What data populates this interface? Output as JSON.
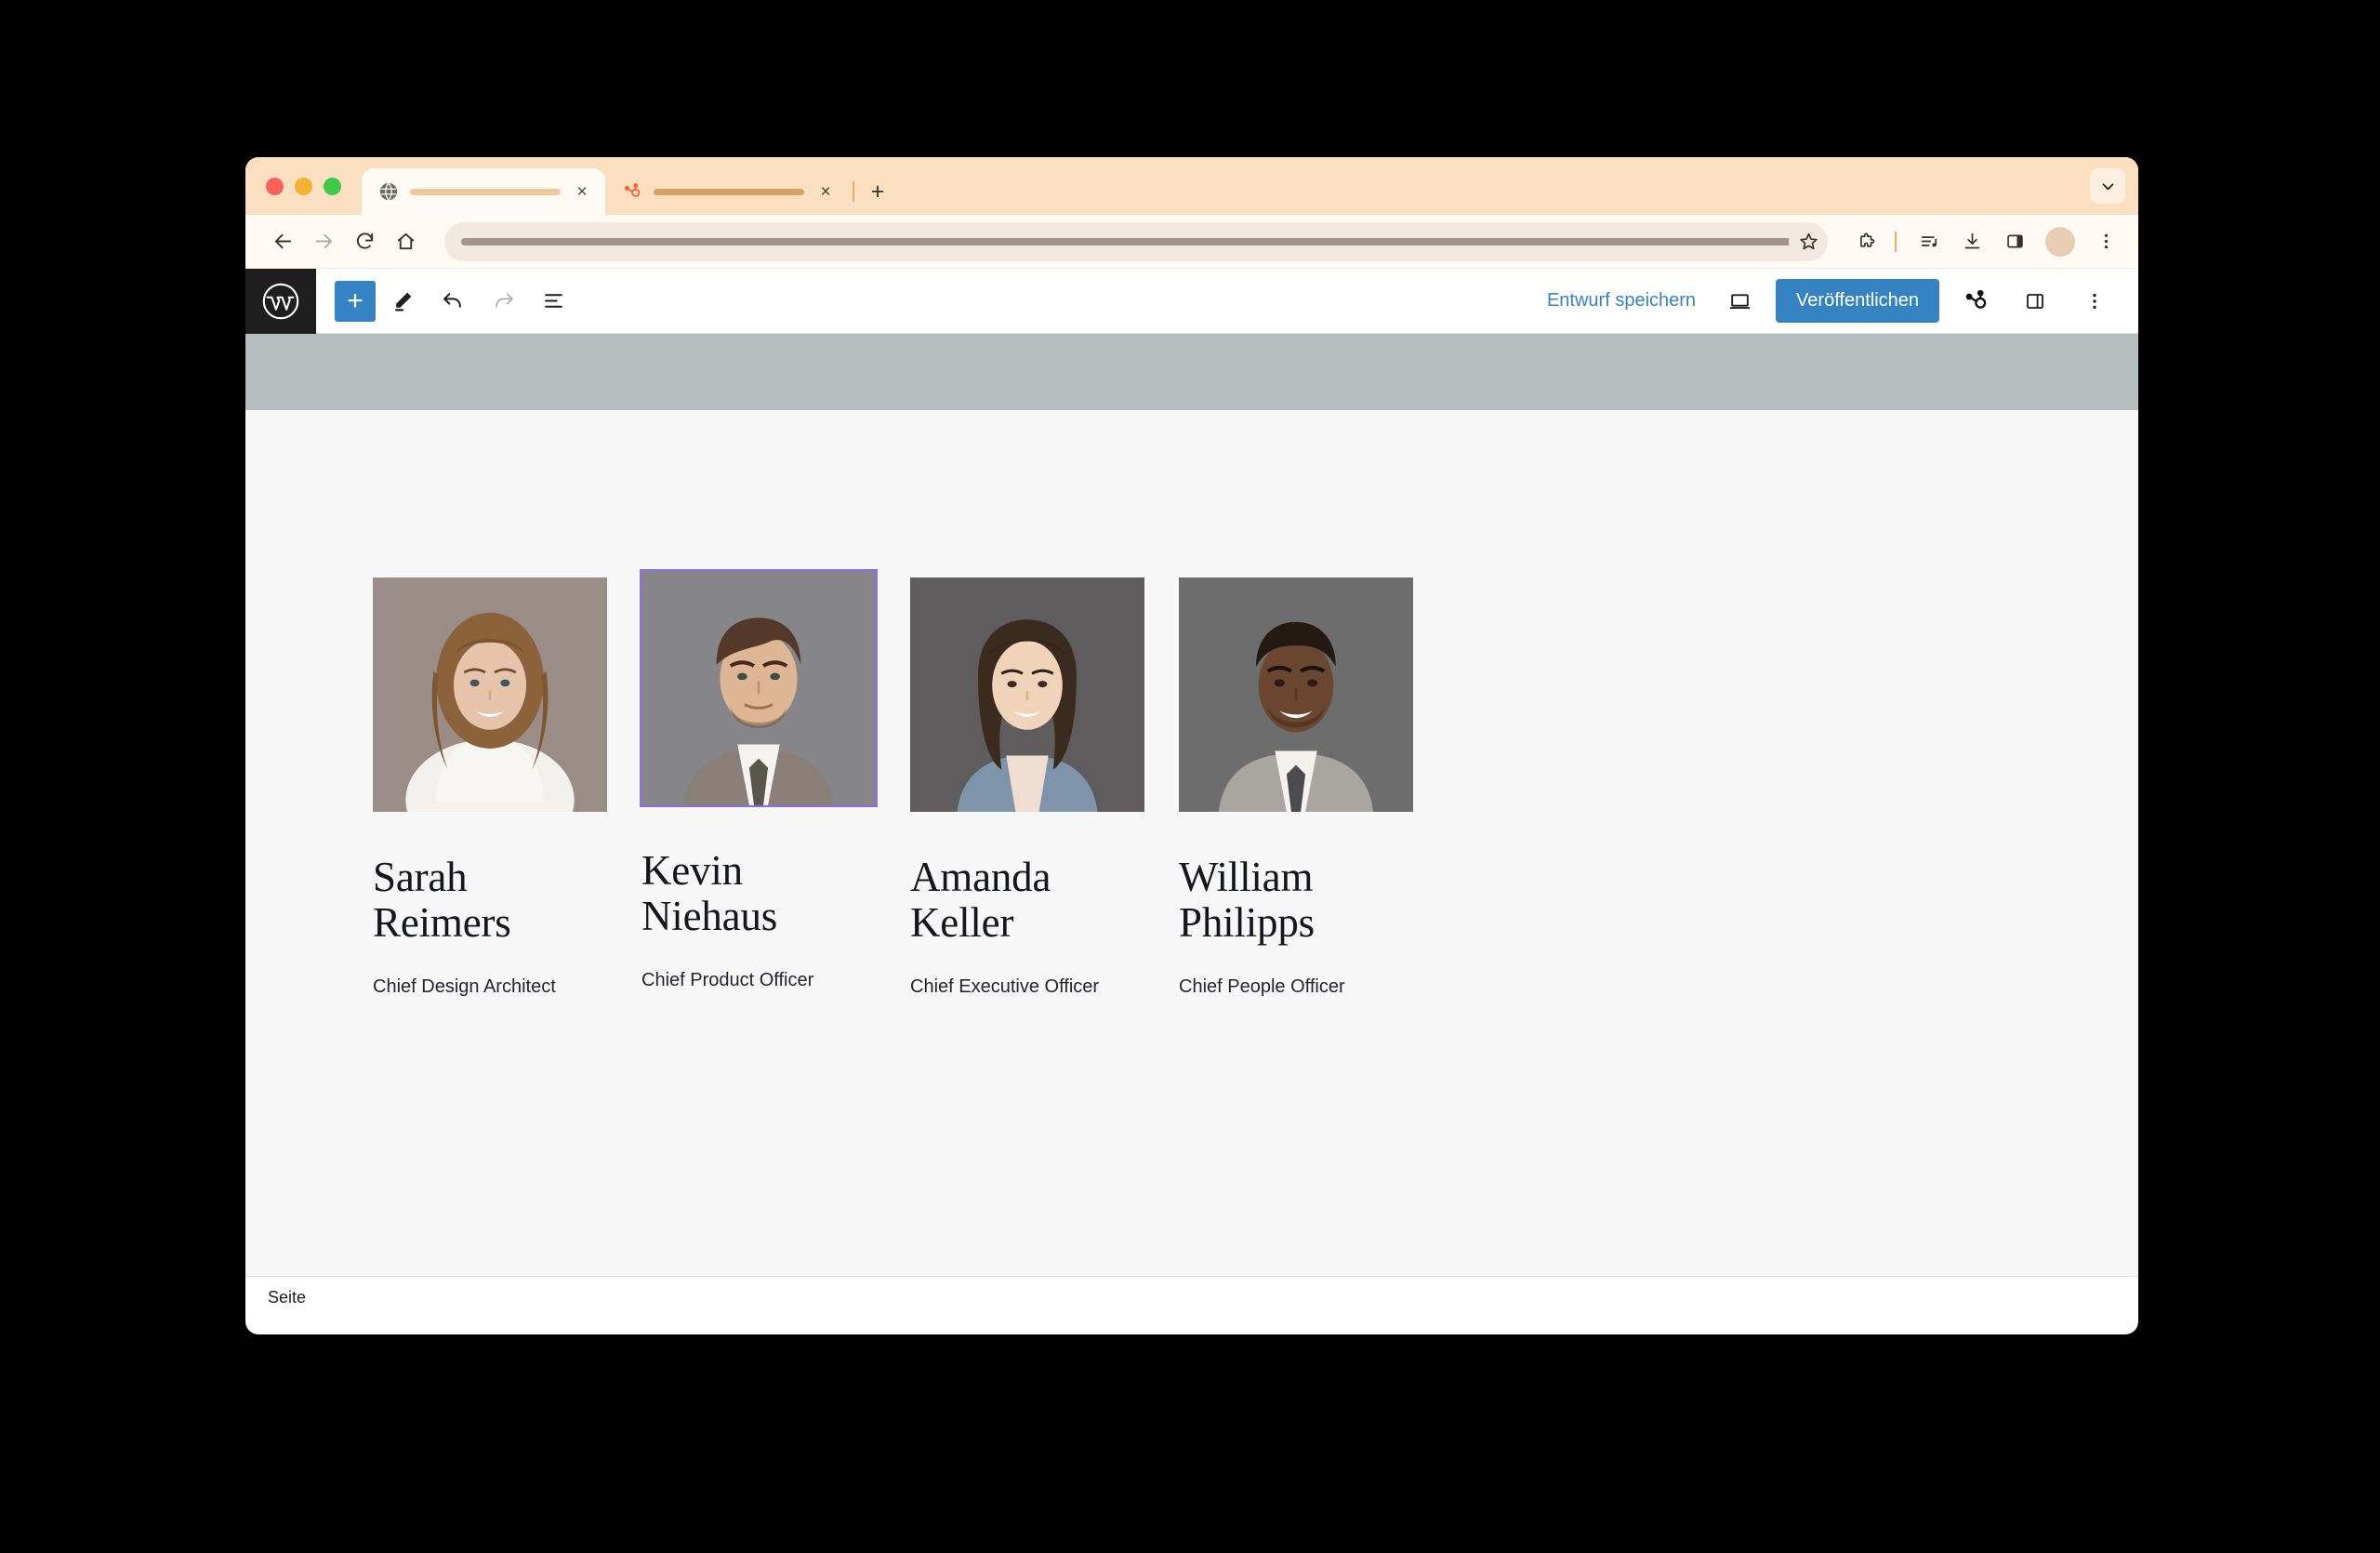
{
  "browser": {
    "window_controls": {
      "close_label": "close",
      "minimize_label": "minimize",
      "zoom_label": "zoom"
    },
    "tabs": [
      {
        "title": "",
        "favicon": "globe-icon",
        "active": true,
        "close_label": "×"
      },
      {
        "title": "",
        "favicon": "hubspot-icon",
        "active": false,
        "close_label": "×"
      }
    ],
    "new_tab_label": "+",
    "tab_search_label": "⌄",
    "nav": {
      "back_label": "←",
      "forward_label": "→",
      "reload_label": "⟳",
      "home_label": "⌂"
    },
    "omnibox": {
      "value": "",
      "placeholder": ""
    },
    "toolbar_icons": [
      "bookmark-star-icon",
      "extensions-icon",
      "media-playlist-icon",
      "downloads-icon",
      "side-panel-icon",
      "profile-avatar",
      "browser-menu-icon"
    ],
    "theme": {
      "titlebar": "#fadfc0",
      "toolbar": "#fffaf4",
      "omnibox": "#f1e8e0",
      "accent": "#efab63"
    }
  },
  "editor": {
    "logo_label": "WordPress",
    "toolbar_left": [
      {
        "name": "add-block",
        "label": "+"
      },
      {
        "name": "edit-tool",
        "label": "Werkzeuge"
      },
      {
        "name": "undo",
        "label": "Rückgängig"
      },
      {
        "name": "redo",
        "label": "Wiederholen",
        "disabled": true
      },
      {
        "name": "document-overview",
        "label": "Dokumentübersicht"
      }
    ],
    "save_draft_label": "Entwurf speichern",
    "preview_label": "Vorschau",
    "publish_label": "Veröffentlichen",
    "hubspot_label": "HubSpot",
    "settings_label": "Einstellungen",
    "options_label": "Optionen",
    "breadcrumb": "Seite",
    "accent_color": "#3583c3",
    "selection_color": "#8a6ee8",
    "cover_band_color": "#b6bebd",
    "canvas_color": "#f7f7f7"
  },
  "team": {
    "members": [
      {
        "name": "Sarah Reimers",
        "name_line1": "Sarah",
        "name_line2": "Reimers",
        "role": "Chief Design Architect",
        "selected": false,
        "photo": {
          "bg": "#9a8d87",
          "skin": "#e6c4ab",
          "hair": "#8b6239",
          "clothes": "#f2f0ec",
          "hair_style": "long-wavy"
        }
      },
      {
        "name": "Kevin Niehaus",
        "name_line1": "Kevin",
        "name_line2": "Niehaus",
        "role": "Chief Product Officer",
        "selected": true,
        "photo": {
          "bg": "#86858a",
          "skin": "#dfb693",
          "hair": "#54382a",
          "clothes": "#8a7f78",
          "hair_style": "short-swept"
        }
      },
      {
        "name": "Amanda Keller",
        "name_line1": "Amanda",
        "name_line2": "Keller",
        "role": "Chief Executive Officer",
        "selected": false,
        "photo": {
          "bg": "#5e5c5c",
          "skin": "#f0d3b8",
          "hair": "#3b2a1e",
          "clothes": "#7d94ab",
          "hair_style": "long-straight"
        }
      },
      {
        "name": "William Philipps",
        "name_line1": "William",
        "name_line2": "Philipps",
        "role": "Chief People Officer",
        "selected": false,
        "photo": {
          "bg": "#6d6d6d",
          "skin": "#6b4630",
          "hair": "#241a14",
          "clothes": "#a9a5a0",
          "hair_style": "short-cropped"
        }
      }
    ]
  }
}
